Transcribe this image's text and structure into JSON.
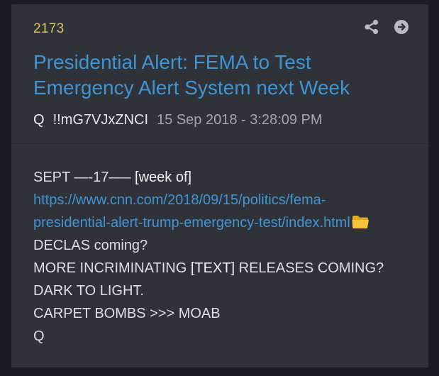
{
  "post": {
    "number": "2173",
    "title_line1": "Presidential Alert: FEMA to Test",
    "title_line2": "Emergency Alert System next Week",
    "author": "Q",
    "tripcode": "!!mG7VJxZNCI",
    "timestamp": "15 Sep 2018 - 3:28:09 PM"
  },
  "icons": {
    "share": "share-icon",
    "open": "arrow-right-circle-icon",
    "folder": "folder-icon"
  },
  "colors": {
    "background": "#1c1d22",
    "card": "#303239",
    "post_number": "#d8c55a",
    "link": "#3f94d3",
    "text": "#dddfe3"
  },
  "body": {
    "line1_text": "SEPT —-17—– ",
    "line1_bracket": "[week of]",
    "link_line1": "https://www.cnn.com/2018/09/15/politics/fema-",
    "link_line2": "presidential-alert-trump-emergency-test/index.html",
    "line4": "DECLAS coming?",
    "line5_pre": "MORE INCRIMINATING ",
    "line5_bracket": "[TEXT]",
    "line5_post": " RELEASES COMING?",
    "line6": "DARK TO LIGHT.",
    "line7": "CARPET BOMBS >>> MOAB",
    "signature": "Q"
  }
}
